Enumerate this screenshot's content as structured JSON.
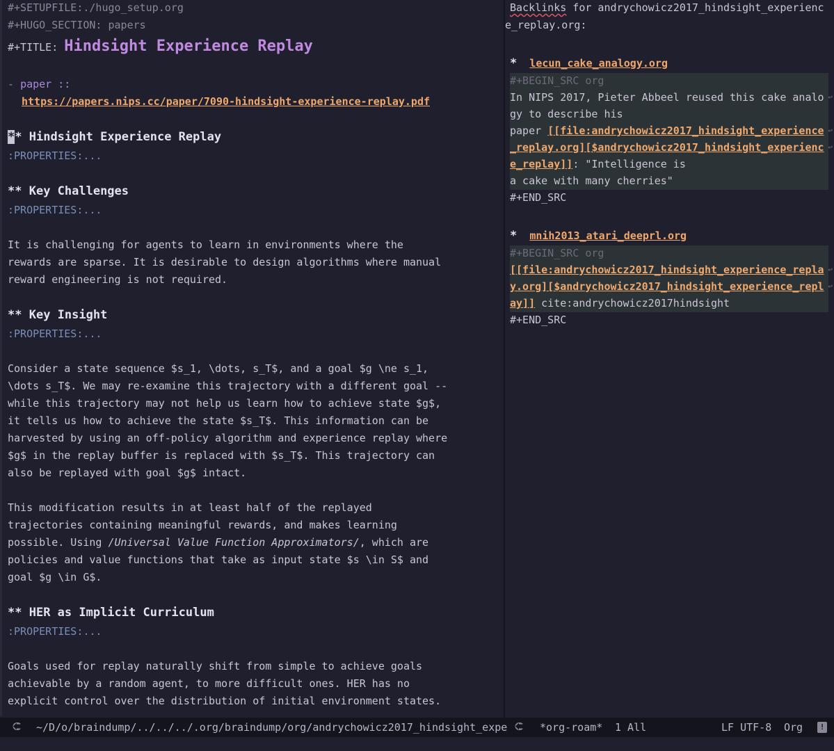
{
  "left_buffer": {
    "setupfile": "#+SETUPFILE:./hugo_setup.org",
    "hugo_section": "#+HUGO_SECTION: papers",
    "title_keyword": "#+TITLE: ",
    "title": "Hindsight Experience Replay",
    "paper_bullet": "- ",
    "paper_label": "paper ::",
    "paper_url": "https://papers.nips.cc/paper/7090-hindsight-experience-replay.pdf",
    "sections": [
      {
        "stars": "**",
        "heading": " Hindsight Experience Replay",
        "properties": ":PROPERTIES:...",
        "lines": []
      },
      {
        "stars": "**",
        "heading": " Key Challenges",
        "properties": ":PROPERTIES:...",
        "lines": [
          "It is challenging for agents to learn in environments where the",
          "rewards are sparse. It is desirable to design algorithms where manual",
          "reward engineering is not required."
        ]
      },
      {
        "stars": "**",
        "heading": " Key Insight",
        "properties": ":PROPERTIES:...",
        "lines": [
          "Consider a state sequence $s_1, \\dots, s_T$, and a goal $g \\ne s_1,",
          "\\dots s_T$. We may re-examine this trajectory with a different goal --",
          "while this trajectory may not help us learn how to achieve state $g$,",
          "it tells us how to achieve the state $s_T$. This information can be",
          "harvested by using an off-policy algorithm and experience replay where",
          "$g$ in the replay buffer is replaced with $s_T$. This trajectory can",
          "also be replayed with goal $g$ intact."
        ],
        "lines2_a": "This modification results in at least half of the replayed",
        "lines2_b": "trajectories containing meaningful rewards, and makes learning",
        "lines2_c_pre": "possible. Using ",
        "lines2_c_italic": "/Universal Value Function Approximators/",
        "lines2_c_post": ", which are",
        "lines2_d": "policies and value functions that take as input state $s \\in S$ and",
        "lines2_e": "goal $g \\in G$."
      },
      {
        "stars": "**",
        "heading": " HER as Implicit Curriculum",
        "properties": ":PROPERTIES:...",
        "lines": [
          "Goals used for replay naturally shift from simple to achieve goals",
          "achievable by a random agent, to more difficult ones. HER has no",
          "explicit control over the distribution of initial environment states."
        ]
      }
    ]
  },
  "right_buffer": {
    "header_cursor": "B",
    "header_squig": "acklinks",
    "header_rest": " for andrychowicz2017_hindsight_experienc",
    "header_cont": "e_replay.org:",
    "entries": [
      {
        "star": "*",
        "file": "lecun_cake_analogy.org",
        "begin": "#+BEGIN_SRC org",
        "l1": "In NIPS 2017, Pieter Abbeel reused this cake analo",
        "l2": "gy to describe his",
        "l3_pre": "paper ",
        "l3_link": "[[file:andrychowicz2017_hindsight_experience",
        "l4_link": "_replay.org][$andrychowicz2017_hindsight_experienc",
        "l5_link": "e_replay]]",
        "l5_post": ": \"Intelligence is",
        "l6": "a cake with many cherries\"",
        "end": "#+END_SRC"
      },
      {
        "star": "*",
        "file": "mnih2013_atari_deeprl.org",
        "begin": "#+BEGIN_SRC org",
        "l1_link": "[[file:andrychowicz2017_hindsight_experience_repla",
        "l2_link": "y.org][$andrychowicz2017_hindsight_experience_repl",
        "l3_link": "ay]]",
        "l3_post": " cite:andrychowicz2017hindsight",
        "end": "#+END_SRC"
      }
    ]
  },
  "modeline": {
    "left_path": "~/D/o/braindump/../../../.org/braindump/org/andrychowicz2017_hindsight_expe",
    "right_buffer": "*org-roam*",
    "position": "1 All",
    "encoding": "LF UTF-8",
    "mode": "Org",
    "icons": [
      "evil-icon",
      "warning-icon"
    ]
  },
  "colors": {
    "background": "#1f1f2d",
    "title": "#c08ae0",
    "link": "#f0a86c",
    "properties": "#7a8eb8",
    "src_block_bg": "#2c3336"
  }
}
